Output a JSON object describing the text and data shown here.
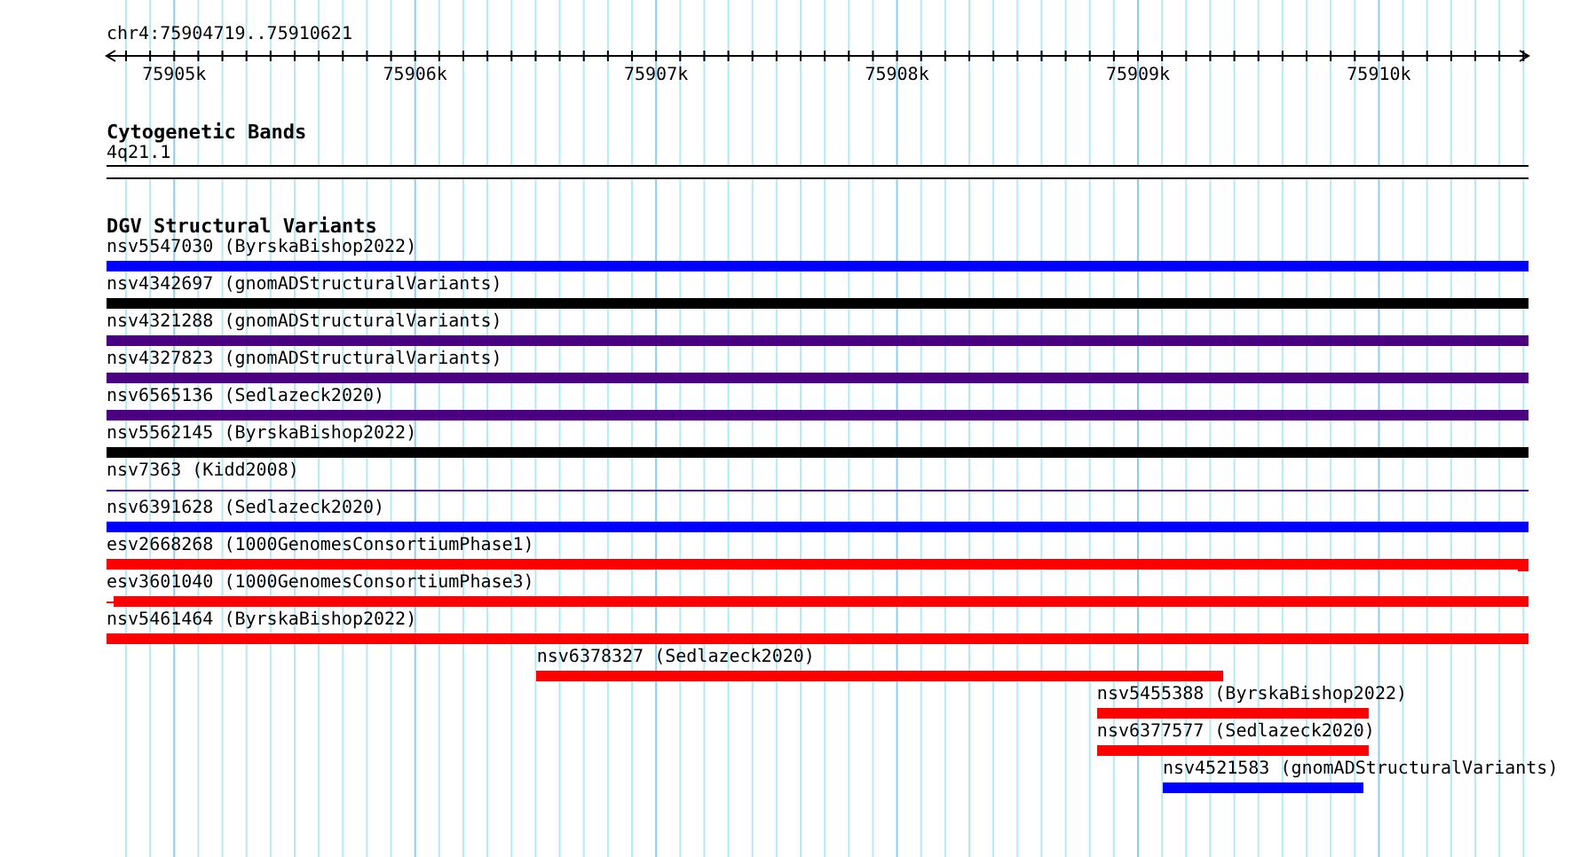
{
  "position": "chr4:75904719..75910621",
  "ruler": {
    "tick_labels": [
      "75905k",
      "75906k",
      "75907k",
      "75908k",
      "75909k",
      "75910k"
    ]
  },
  "cytoband_track": {
    "title": "Cytogenetic Bands",
    "band": "4q21.1"
  },
  "variant_track": {
    "title": "DGV Structural Variants",
    "features": [
      {
        "label": "nsv5547030 (ByrskaBishop2022)",
        "kind": "bar",
        "color": "#0000ff"
      },
      {
        "label": "nsv4342697 (gnomADStructuralVariants)",
        "kind": "bar",
        "color": "#000000"
      },
      {
        "label": "nsv4321288 (gnomADStructuralVariants)",
        "kind": "bar",
        "color": "#4b0082"
      },
      {
        "label": "nsv4327823 (gnomADStructuralVariants)",
        "kind": "bar",
        "color": "#4b0082"
      },
      {
        "label": "nsv6565136 (Sedlazeck2020)",
        "kind": "bar",
        "color": "#4b0082"
      },
      {
        "label": "nsv5562145 (ByrskaBishop2022)",
        "kind": "bar",
        "color": "#000000"
      },
      {
        "label": "nsv7363 (Kidd2008)",
        "kind": "line",
        "color": "#4b0082"
      },
      {
        "label": "nsv6391628 (Sedlazeck2020)",
        "kind": "bar",
        "color": "#0000ff"
      },
      {
        "label": "esv2668268 (1000GenomesConsortiumPhase1)",
        "kind": "bar",
        "color": "#ff0000"
      },
      {
        "label": "esv3601040 (1000GenomesConsortiumPhase3)",
        "kind": "bar",
        "color": "#ff0000"
      },
      {
        "label": "nsv5461464 (ByrskaBishop2022)",
        "kind": "bar",
        "color": "#ff0000"
      },
      {
        "label": "nsv6378327 (Sedlazeck2020)",
        "kind": "bar",
        "color": "#ff0000"
      },
      {
        "label": "nsv5455388 (ByrskaBishop2022)",
        "kind": "bar",
        "color": "#ff0000"
      },
      {
        "label": "nsv6377577 (Sedlazeck2020)",
        "kind": "bar",
        "color": "#ff0000"
      },
      {
        "label": "nsv4521583 (gnomADStructuralVariants)",
        "kind": "bar",
        "color": "#0000ff"
      }
    ]
  }
}
